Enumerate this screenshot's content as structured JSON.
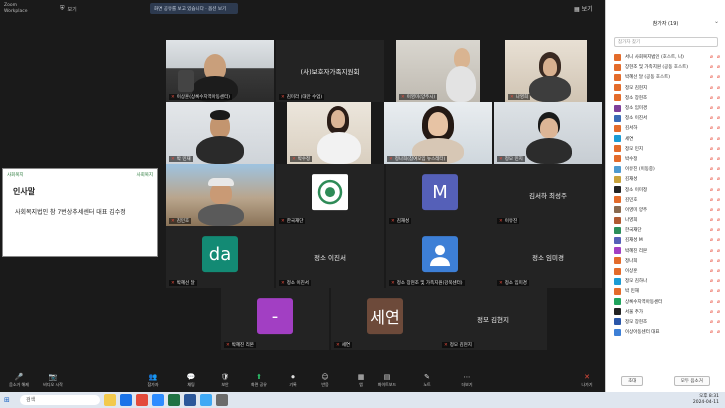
{
  "topbar": {
    "app_line1": "Zoom",
    "app_line2": "Workplace",
    "zoom_label": "보기",
    "share_bar_label": "화면 공유를 보고 있습니다 · 옵션 보기",
    "view_label": "보기"
  },
  "shared_screen": {
    "logo_left": "사회복지",
    "logo_right": "사회복지",
    "title": "인사말",
    "line": "사회복지법인 참 7번상추세센터 대표 김수정"
  },
  "tiles": [
    {
      "id": "t1",
      "name": "이상훈(상록수지역아동센터)",
      "type": "video"
    },
    {
      "id": "t2",
      "name": "김미라 (대만 수업)",
      "type": "text",
      "text": "(사)보호자가족지원회"
    },
    {
      "id": "t3",
      "name": "이영미(양주시)",
      "type": "video"
    },
    {
      "id": "t4",
      "name": "나영희",
      "type": "video"
    },
    {
      "id": "t5",
      "name": "박 민재",
      "type": "video"
    },
    {
      "id": "t6",
      "name": "박수정",
      "type": "video"
    },
    {
      "id": "t7",
      "name": "정나희(참여모임 뉴스레터)",
      "type": "video"
    },
    {
      "id": "t8",
      "name": "정모 민지",
      "type": "video"
    },
    {
      "id": "t9",
      "name": "김민호",
      "type": "video"
    },
    {
      "id": "t10",
      "name": "한국재단",
      "type": "logo"
    },
    {
      "id": "t11",
      "name": "김재성",
      "type": "avatar",
      "letter": "M",
      "color": "#5560b8"
    },
    {
      "id": "t12",
      "name": "이유진",
      "type": "text",
      "text": "김서하 최성주"
    },
    {
      "id": "t13",
      "name": "박혜선 달",
      "type": "avatar",
      "letter": "da",
      "color": "#138a74"
    },
    {
      "id": "t14",
      "name": "정소 이진서",
      "type": "text",
      "text": "정소 이진서"
    },
    {
      "id": "t15",
      "name": "정소 장현조 및 가족지원(강북센터)",
      "type": "icon",
      "color": "#3d7fd6"
    },
    {
      "id": "t16",
      "name": "정소 임미경",
      "type": "text",
      "text": "정소 임미경"
    },
    {
      "id": "t17",
      "name": "박혜진 리본",
      "type": "avatar",
      "letter": "-",
      "color": "#a23fc3"
    },
    {
      "id": "t18",
      "name": "세연",
      "type": "avatar",
      "letter": "세연",
      "color": "#6d4a3a"
    },
    {
      "id": "t19",
      "name": "정모 김현지",
      "type": "text",
      "text": "정모 김현지"
    }
  ],
  "toolbar": {
    "items": [
      {
        "icon": "🎤",
        "label": "음소거 해제"
      },
      {
        "icon": "📷",
        "label": "비디오 시작"
      },
      {
        "icon": "👥",
        "label": "참가자"
      },
      {
        "icon": "💬",
        "label": "채팅"
      },
      {
        "icon": "🛡",
        "label": "보안"
      },
      {
        "icon": "⬆",
        "label": "화면 공유"
      },
      {
        "icon": "⏺",
        "label": "기록"
      },
      {
        "icon": "☺",
        "label": "반응"
      },
      {
        "icon": "▦",
        "label": "앱"
      },
      {
        "icon": "▤",
        "label": "화이트보드"
      },
      {
        "icon": "✎",
        "label": "노트"
      },
      {
        "icon": "⋯",
        "label": "더보기"
      },
      {
        "icon": "✕",
        "label": "나가기"
      }
    ]
  },
  "participants_panel": {
    "title": "참가자 (19)",
    "search_placeholder": "참가자 찾기",
    "items": [
      {
        "name": "서니 사회복지법인 (호스트, 나)",
        "color": "#e36b2a"
      },
      {
        "name": "장현조 및 가족지원 (공동 호스트)",
        "color": "#e36b2a"
      },
      {
        "name": "박혜선 달 (공동 호스트)",
        "color": "#e36b2a"
      },
      {
        "name": "정모 김현지",
        "color": "#e36b2a"
      },
      {
        "name": "정소 장현조",
        "color": "#e36b2a"
      },
      {
        "name": "정소 임미경",
        "color": "#7e3f99"
      },
      {
        "name": "정소 이진서",
        "color": "#3a6bb5"
      },
      {
        "name": "김서하",
        "color": "#e36b2a"
      },
      {
        "name": "세연",
        "color": "#1a9bd4"
      },
      {
        "name": "정모 민지",
        "color": "#e36b2a"
      },
      {
        "name": "박수정",
        "color": "#e36b2a"
      },
      {
        "name": "이유진 (이동중)",
        "color": "#4d9ad0"
      },
      {
        "name": "김재성",
        "color": "#c7a23c"
      },
      {
        "name": "정소 이미정",
        "color": "#222222"
      },
      {
        "name": "김민호",
        "color": "#e36b2a"
      },
      {
        "name": "이영미 양주",
        "color": "#8a6a4f"
      },
      {
        "name": "나영희",
        "color": "#b05a32"
      },
      {
        "name": "한국재단",
        "color": "#2a8f5a"
      },
      {
        "name": "김재성 M",
        "color": "#5560b8"
      },
      {
        "name": "박혜진 리본",
        "color": "#a23fc3"
      },
      {
        "name": "정나희",
        "color": "#e36b2a"
      },
      {
        "name": "이상훈",
        "color": "#e36b2a"
      },
      {
        "name": "정모 김하나",
        "color": "#1a9bd4"
      },
      {
        "name": "박 민재",
        "color": "#e36b2a"
      },
      {
        "name": "상록수지역아동센터",
        "color": "#1fa35c"
      },
      {
        "name": "서울 추가",
        "color": "#222222"
      },
      {
        "name": "정모 장현조",
        "color": "#2a56a8"
      },
      {
        "name": "이상아동센터 대표",
        "color": "#3d7fd6"
      }
    ],
    "invite_label": "초대",
    "mute_all_label": "모두 음소거"
  },
  "taskbar": {
    "search_placeholder": "검색",
    "time": "오후 8:31",
    "date": "2024-04-11"
  }
}
